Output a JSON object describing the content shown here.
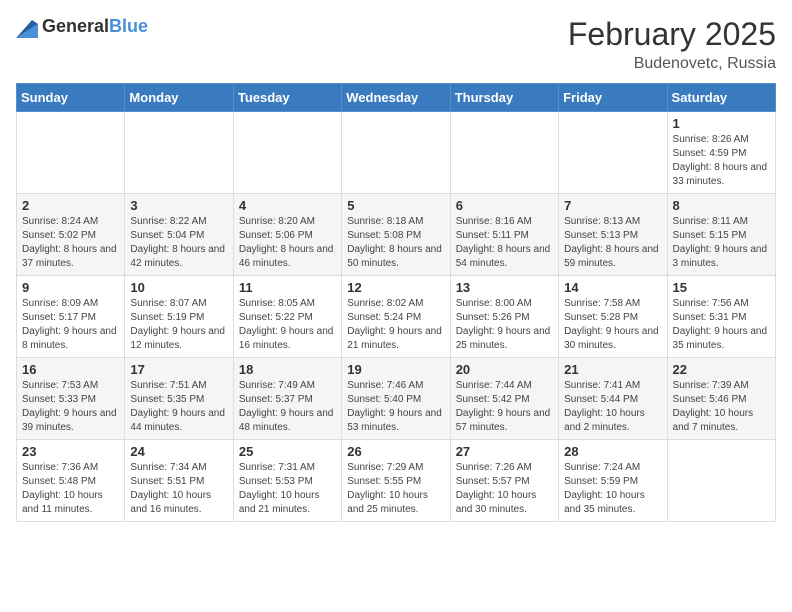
{
  "logo": {
    "general": "General",
    "blue": "Blue"
  },
  "title": "February 2025",
  "subtitle": "Budenovetc, Russia",
  "days_of_week": [
    "Sunday",
    "Monday",
    "Tuesday",
    "Wednesday",
    "Thursday",
    "Friday",
    "Saturday"
  ],
  "weeks": [
    [
      {
        "day": "",
        "info": ""
      },
      {
        "day": "",
        "info": ""
      },
      {
        "day": "",
        "info": ""
      },
      {
        "day": "",
        "info": ""
      },
      {
        "day": "",
        "info": ""
      },
      {
        "day": "",
        "info": ""
      },
      {
        "day": "1",
        "info": "Sunrise: 8:26 AM\nSunset: 4:59 PM\nDaylight: 8 hours and 33 minutes."
      }
    ],
    [
      {
        "day": "2",
        "info": "Sunrise: 8:24 AM\nSunset: 5:02 PM\nDaylight: 8 hours and 37 minutes."
      },
      {
        "day": "3",
        "info": "Sunrise: 8:22 AM\nSunset: 5:04 PM\nDaylight: 8 hours and 42 minutes."
      },
      {
        "day": "4",
        "info": "Sunrise: 8:20 AM\nSunset: 5:06 PM\nDaylight: 8 hours and 46 minutes."
      },
      {
        "day": "5",
        "info": "Sunrise: 8:18 AM\nSunset: 5:08 PM\nDaylight: 8 hours and 50 minutes."
      },
      {
        "day": "6",
        "info": "Sunrise: 8:16 AM\nSunset: 5:11 PM\nDaylight: 8 hours and 54 minutes."
      },
      {
        "day": "7",
        "info": "Sunrise: 8:13 AM\nSunset: 5:13 PM\nDaylight: 8 hours and 59 minutes."
      },
      {
        "day": "8",
        "info": "Sunrise: 8:11 AM\nSunset: 5:15 PM\nDaylight: 9 hours and 3 minutes."
      }
    ],
    [
      {
        "day": "9",
        "info": "Sunrise: 8:09 AM\nSunset: 5:17 PM\nDaylight: 9 hours and 8 minutes."
      },
      {
        "day": "10",
        "info": "Sunrise: 8:07 AM\nSunset: 5:19 PM\nDaylight: 9 hours and 12 minutes."
      },
      {
        "day": "11",
        "info": "Sunrise: 8:05 AM\nSunset: 5:22 PM\nDaylight: 9 hours and 16 minutes."
      },
      {
        "day": "12",
        "info": "Sunrise: 8:02 AM\nSunset: 5:24 PM\nDaylight: 9 hours and 21 minutes."
      },
      {
        "day": "13",
        "info": "Sunrise: 8:00 AM\nSunset: 5:26 PM\nDaylight: 9 hours and 25 minutes."
      },
      {
        "day": "14",
        "info": "Sunrise: 7:58 AM\nSunset: 5:28 PM\nDaylight: 9 hours and 30 minutes."
      },
      {
        "day": "15",
        "info": "Sunrise: 7:56 AM\nSunset: 5:31 PM\nDaylight: 9 hours and 35 minutes."
      }
    ],
    [
      {
        "day": "16",
        "info": "Sunrise: 7:53 AM\nSunset: 5:33 PM\nDaylight: 9 hours and 39 minutes."
      },
      {
        "day": "17",
        "info": "Sunrise: 7:51 AM\nSunset: 5:35 PM\nDaylight: 9 hours and 44 minutes."
      },
      {
        "day": "18",
        "info": "Sunrise: 7:49 AM\nSunset: 5:37 PM\nDaylight: 9 hours and 48 minutes."
      },
      {
        "day": "19",
        "info": "Sunrise: 7:46 AM\nSunset: 5:40 PM\nDaylight: 9 hours and 53 minutes."
      },
      {
        "day": "20",
        "info": "Sunrise: 7:44 AM\nSunset: 5:42 PM\nDaylight: 9 hours and 57 minutes."
      },
      {
        "day": "21",
        "info": "Sunrise: 7:41 AM\nSunset: 5:44 PM\nDaylight: 10 hours and 2 minutes."
      },
      {
        "day": "22",
        "info": "Sunrise: 7:39 AM\nSunset: 5:46 PM\nDaylight: 10 hours and 7 minutes."
      }
    ],
    [
      {
        "day": "23",
        "info": "Sunrise: 7:36 AM\nSunset: 5:48 PM\nDaylight: 10 hours and 11 minutes."
      },
      {
        "day": "24",
        "info": "Sunrise: 7:34 AM\nSunset: 5:51 PM\nDaylight: 10 hours and 16 minutes."
      },
      {
        "day": "25",
        "info": "Sunrise: 7:31 AM\nSunset: 5:53 PM\nDaylight: 10 hours and 21 minutes."
      },
      {
        "day": "26",
        "info": "Sunrise: 7:29 AM\nSunset: 5:55 PM\nDaylight: 10 hours and 25 minutes."
      },
      {
        "day": "27",
        "info": "Sunrise: 7:26 AM\nSunset: 5:57 PM\nDaylight: 10 hours and 30 minutes."
      },
      {
        "day": "28",
        "info": "Sunrise: 7:24 AM\nSunset: 5:59 PM\nDaylight: 10 hours and 35 minutes."
      },
      {
        "day": "",
        "info": ""
      }
    ]
  ]
}
